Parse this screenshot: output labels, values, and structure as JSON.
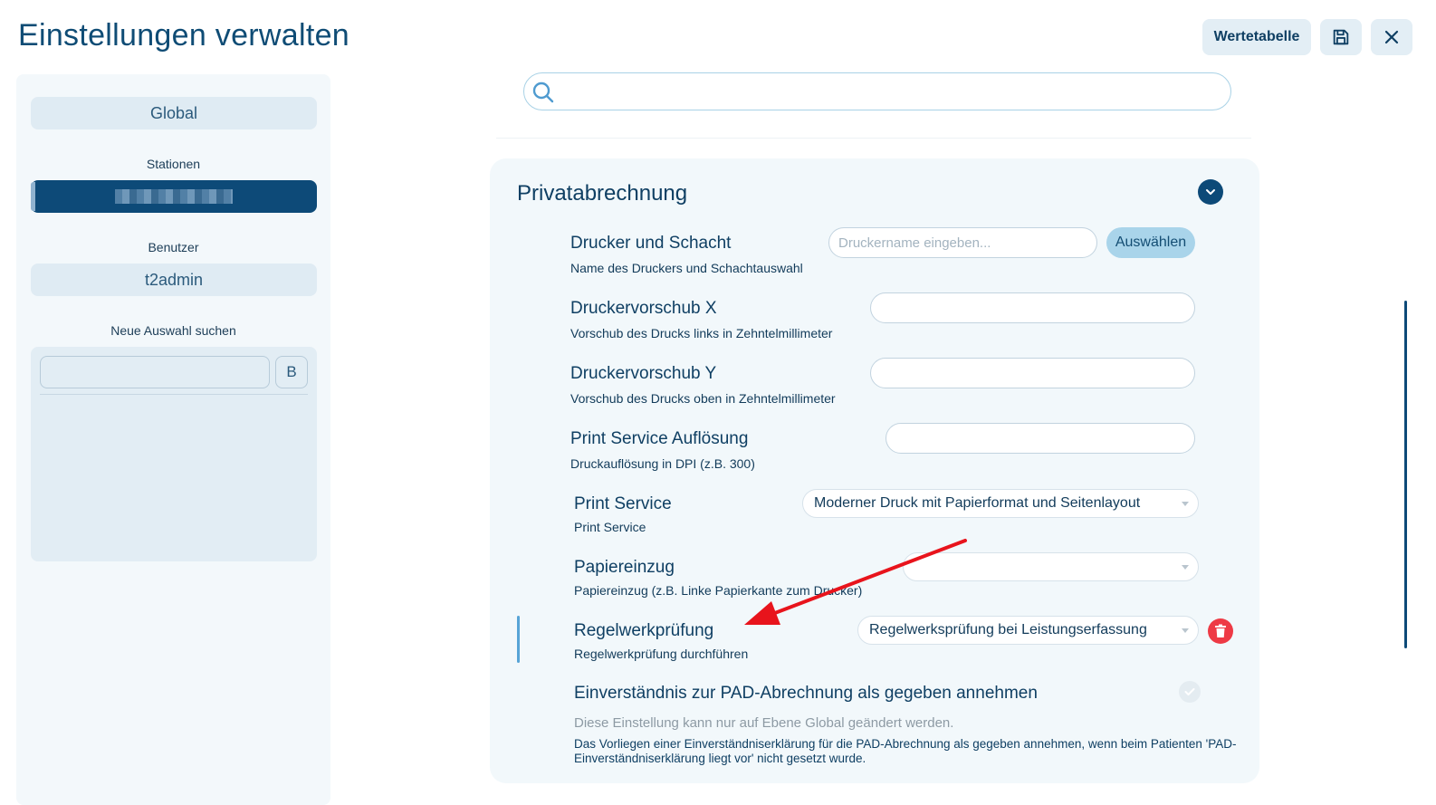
{
  "header": {
    "title": "Einstellungen verwalten",
    "value_table_label": "Wertetabelle"
  },
  "sidebar": {
    "global_label": "Global",
    "stations_heading": "Stationen",
    "users_heading": "Benutzer",
    "user_value": "t2admin",
    "new_search_heading": "Neue Auswahl suchen",
    "search_button_label": "B"
  },
  "section": {
    "title": "Privatabrechnung",
    "rows": [
      {
        "title": "Drucker und Schacht",
        "subtitle": "Name des Druckers und Schachtauswahl",
        "placeholder": "Druckername eingeben...",
        "button_label": "Auswählen"
      },
      {
        "title": "Druckervorschub X",
        "subtitle": "Vorschub des Drucks links in Zehntelmillimeter",
        "value": ""
      },
      {
        "title": "Druckervorschub Y",
        "subtitle": "Vorschub des Drucks oben in Zehntelmillimeter",
        "value": ""
      },
      {
        "title": "Print Service Auflösung",
        "subtitle": "Druckauflösung in DPI (z.B. 300)",
        "value": ""
      },
      {
        "title": "Print Service",
        "subtitle": "Print Service",
        "selected": "Moderner Druck mit Papierformat und Seitenlayout"
      },
      {
        "title": "Papiereinzug",
        "subtitle": "Papiereinzug (z.B. Linke Papierkante zum Drucker)",
        "selected": ""
      },
      {
        "title": "Regelwerkprüfung",
        "subtitle": "Regelwerkprüfung durchführen",
        "selected": "Regelwerksprüfung bei Leistungserfassung"
      },
      {
        "title": "Einverständnis zur PAD-Abrechnung als gegeben annehmen",
        "note": "Diese Einstellung kann nur auf Ebene Global geändert werden.",
        "description": "Das Vorliegen einer Einverständniserklärung für die PAD-Abrechnung als gegeben annehmen, wenn beim Patienten 'PAD-Einverständniserklärung liegt vor' nicht gesetzt wurde."
      }
    ]
  },
  "colors": {
    "primary": "#0d4a78",
    "accent": "#57a4d6",
    "danger": "#ee3a45",
    "annotation_arrow": "#e8141c"
  },
  "icons": [
    "save-icon",
    "close-icon",
    "search-icon",
    "chevron-down-icon",
    "trash-icon",
    "check-icon",
    "annotation-arrow"
  ]
}
